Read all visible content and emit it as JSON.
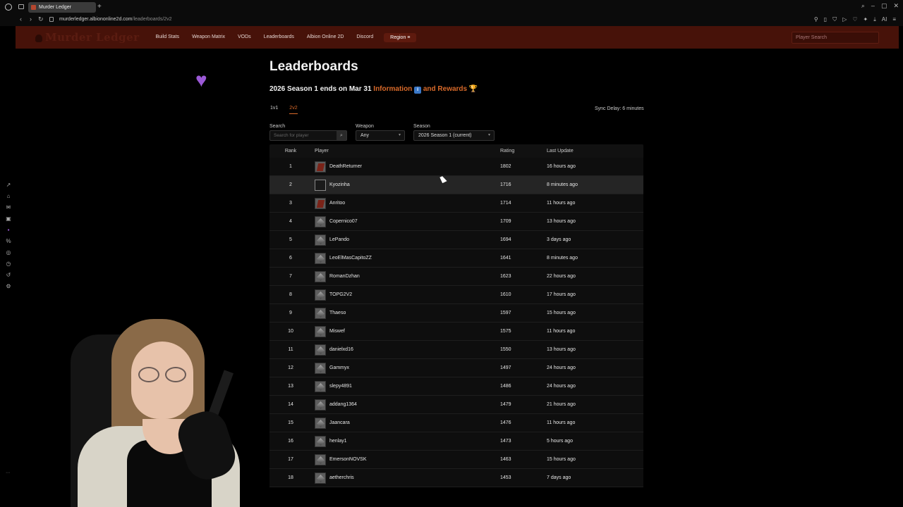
{
  "browser": {
    "tab_title": "Murder Ledger",
    "url_domain": "murderledger.albiononline2d.com",
    "url_path": "/leaderboards/2v2"
  },
  "header": {
    "logo": "Murder Ledger",
    "nav": [
      "Build Stats",
      "Weapon Matrix",
      "VODs",
      "Leaderboards",
      "Albion Online 2D",
      "Discord"
    ],
    "region_label": "Region",
    "player_search_placeholder": "Player Search"
  },
  "page": {
    "title": "Leaderboards",
    "season_text": "2026 Season 1 ends on Mar 31",
    "info_link": "Information",
    "rewards_link": "and Rewards",
    "tabs": [
      "1v1",
      "2v2"
    ],
    "active_tab": "2v2",
    "sync_delay": "Sync Delay: 6 minutes"
  },
  "filters": {
    "search_label": "Search",
    "search_placeholder": "Search for player",
    "weapon_label": "Weapon",
    "weapon_value": "Any",
    "season_label": "Season",
    "season_value": "2026 Season 1 (current)"
  },
  "table": {
    "headers": [
      "Rank",
      "Player",
      "Rating",
      "Last Update"
    ],
    "rows": [
      {
        "rank": "1",
        "player": "DeathReturner",
        "rating": "1802",
        "update": "16 hours ago",
        "avatar": "red"
      },
      {
        "rank": "2",
        "player": "Kyozinha",
        "rating": "1716",
        "update": "8 minutes ago",
        "avatar": "blank"
      },
      {
        "rank": "3",
        "player": "Anritoo",
        "rating": "1714",
        "update": "11 hours ago",
        "avatar": "red"
      },
      {
        "rank": "4",
        "player": "Copernico07",
        "rating": "1709",
        "update": "13 hours ago",
        "avatar": "grey"
      },
      {
        "rank": "5",
        "player": "LePando",
        "rating": "1694",
        "update": "3 days ago",
        "avatar": "grey"
      },
      {
        "rank": "6",
        "player": "LeoElMasCapitoZZ",
        "rating": "1641",
        "update": "8 minutes ago",
        "avatar": "grey"
      },
      {
        "rank": "7",
        "player": "RomanDzhan",
        "rating": "1623",
        "update": "22 hours ago",
        "avatar": "grey"
      },
      {
        "rank": "8",
        "player": "TOPG2V2",
        "rating": "1610",
        "update": "17 hours ago",
        "avatar": "grey"
      },
      {
        "rank": "9",
        "player": "Thaeso",
        "rating": "1597",
        "update": "15 hours ago",
        "avatar": "grey"
      },
      {
        "rank": "10",
        "player": "Miswef",
        "rating": "1575",
        "update": "11 hours ago",
        "avatar": "grey"
      },
      {
        "rank": "11",
        "player": "danielxd16",
        "rating": "1550",
        "update": "13 hours ago",
        "avatar": "grey"
      },
      {
        "rank": "12",
        "player": "Gammyx",
        "rating": "1497",
        "update": "24 hours ago",
        "avatar": "grey"
      },
      {
        "rank": "13",
        "player": "slepy4891",
        "rating": "1486",
        "update": "24 hours ago",
        "avatar": "grey"
      },
      {
        "rank": "14",
        "player": "addang1364",
        "rating": "1479",
        "update": "21 hours ago",
        "avatar": "grey"
      },
      {
        "rank": "15",
        "player": "Jaancara",
        "rating": "1476",
        "update": "11 hours ago",
        "avatar": "grey"
      },
      {
        "rank": "16",
        "player": "henlay1",
        "rating": "1473",
        "update": "5 hours ago",
        "avatar": "grey"
      },
      {
        "rank": "17",
        "player": "EmersonNOVSK",
        "rating": "1463",
        "update": "15 hours ago",
        "avatar": "grey"
      },
      {
        "rank": "18",
        "player": "aetherchris",
        "rating": "1453",
        "update": "7 days ago",
        "avatar": "grey"
      }
    ]
  },
  "colors": {
    "header_bg": "#471209",
    "accent": "#d96a2a",
    "heart": "#9b59d6"
  }
}
